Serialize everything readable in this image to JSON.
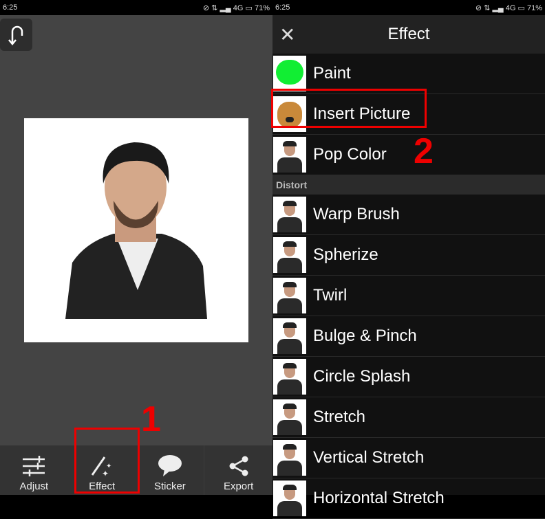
{
  "status": {
    "time": "6:25",
    "network": "4G",
    "battery": "71%"
  },
  "editor": {
    "tools": [
      {
        "label": "Adjust",
        "icon": "sliders-icon"
      },
      {
        "label": "Effect",
        "icon": "magic-wand-icon"
      },
      {
        "label": "Sticker",
        "icon": "speech-bubble-icon"
      },
      {
        "label": "Export",
        "icon": "share-icon"
      }
    ]
  },
  "annotations": {
    "step1": "1",
    "step2": "2"
  },
  "effect": {
    "title": "Effect",
    "items1": [
      "Paint",
      "Insert Picture",
      "Pop Color"
    ],
    "section": "Distort",
    "items2": [
      "Warp Brush",
      "Spherize",
      "Twirl",
      "Bulge & Pinch",
      "Circle Splash",
      "Stretch",
      "Vertical Stretch",
      "Horizontal Stretch"
    ]
  },
  "colors": {
    "highlight": "#e00000"
  }
}
